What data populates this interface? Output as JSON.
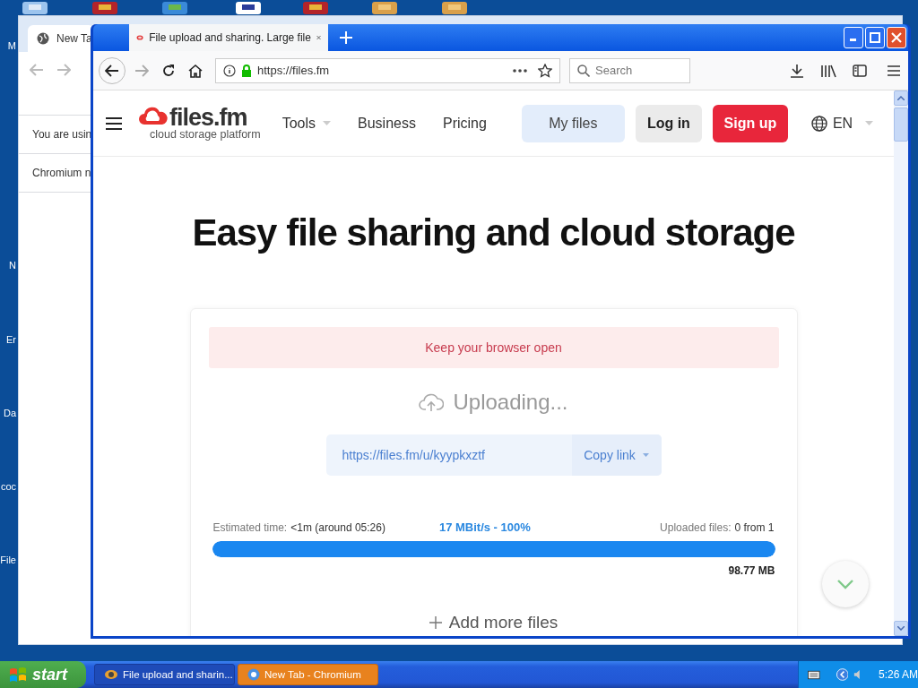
{
  "desktop": {
    "icon_labels": [
      "M",
      "N",
      "Er",
      "Da",
      "coc",
      "File"
    ]
  },
  "background_window": {
    "tab": "New Ta",
    "lines": [
      "You are usin",
      "Chromium n"
    ]
  },
  "browser": {
    "tab_title": "File upload and sharing. Large file",
    "url": "https://files.fm",
    "search_placeholder": "Search"
  },
  "site": {
    "logo": "files.fm",
    "tagline": "cloud storage platform",
    "nav": [
      {
        "label": "Tools",
        "has_menu": true
      },
      {
        "label": "Business",
        "has_menu": false
      },
      {
        "label": "Pricing",
        "has_menu": false
      }
    ],
    "my_files": "My files",
    "login": "Log in",
    "signup": "Sign up",
    "language": "EN"
  },
  "heading": "Easy file sharing and cloud storage",
  "upload": {
    "notice": "Keep your browser open",
    "status": "Uploading...",
    "link": "https://files.fm/u/kyypkxztf",
    "copy": "Copy link",
    "estimated_label": "Estimated time:",
    "estimated_value": "<1m (around 05:26)",
    "speed": "17 MBit/s - 100%",
    "uploaded_label": "Uploaded files:",
    "uploaded_value": "0 from 1",
    "level": 1,
    "size": "98.77 MB",
    "add_more": "Add more files"
  },
  "taskbar": {
    "start": "start",
    "tasks": [
      {
        "label": "File upload and sharin...",
        "flashing": false
      },
      {
        "label": "New Tab - Chromium",
        "flashing": true
      }
    ],
    "clock": "5:26 AM"
  }
}
